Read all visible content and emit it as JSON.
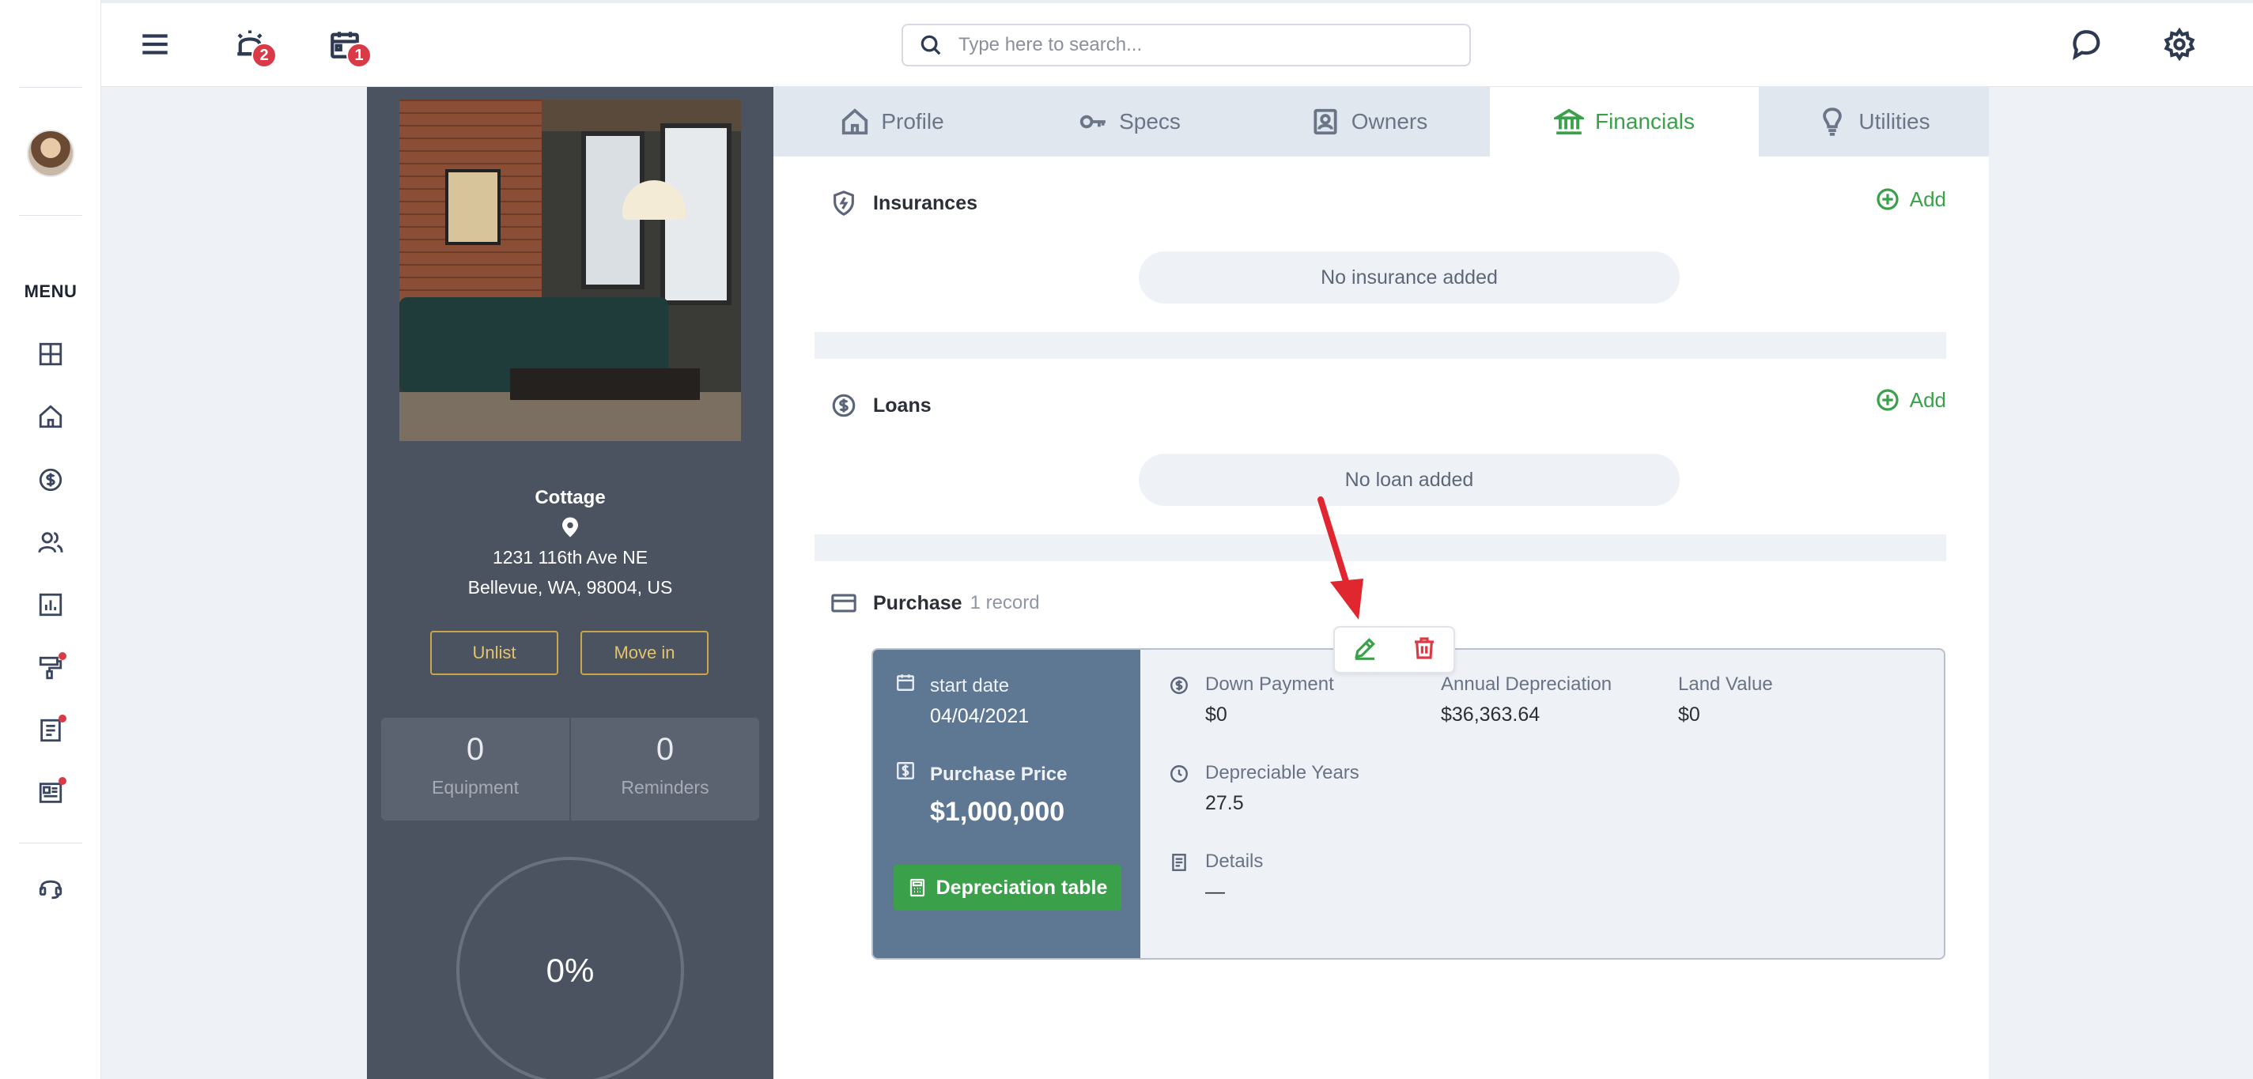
{
  "topbar": {
    "search_placeholder": "Type here to search...",
    "alerts_badge": "2",
    "calendar_badge": "1"
  },
  "sidebar": {
    "menu_label": "MENU"
  },
  "property": {
    "title": "Cottage",
    "address_line1": "1231 116th Ave NE",
    "address_line2": "Bellevue, WA, 98004, US",
    "unlist_label": "Unlist",
    "move_in_label": "Move in",
    "equipment_count": "0",
    "equipment_label": "Equipment",
    "reminders_count": "0",
    "reminders_label": "Reminders",
    "progress": "0%"
  },
  "tabs": [
    {
      "label": "Profile",
      "icon": "home-icon"
    },
    {
      "label": "Specs",
      "icon": "key-icon"
    },
    {
      "label": "Owners",
      "icon": "owner-badge-icon"
    },
    {
      "label": "Financials",
      "icon": "bank-icon",
      "active": true
    },
    {
      "label": "Utilities",
      "icon": "lightbulb-icon"
    }
  ],
  "insurances": {
    "title": "Insurances",
    "add_label": "Add",
    "empty_text": "No insurance added"
  },
  "loans": {
    "title": "Loans",
    "add_label": "Add",
    "empty_text": "No loan added"
  },
  "purchase": {
    "title": "Purchase",
    "record_count": "1 record",
    "start_date_label": "start date",
    "start_date": "04/04/2021",
    "purchase_price_label": "Purchase Price",
    "purchase_price": "$1,000,000",
    "depreciation_button": "Depreciation table",
    "down_payment_label": "Down Payment",
    "down_payment": "$0",
    "annual_depreciation_label": "Annual Depreciation",
    "annual_depreciation": "$36,363.64",
    "land_value_label": "Land Value",
    "land_value": "$0",
    "depreciable_years_label": "Depreciable Years",
    "depreciable_years": "27.5",
    "details_label": "Details",
    "details": "—"
  },
  "colors": {
    "accent_green": "#3aa04a",
    "danger_red": "#d93a45",
    "panel_dark": "#4b5260",
    "card_blue": "#5e7894",
    "gold": "#c9a54a"
  }
}
